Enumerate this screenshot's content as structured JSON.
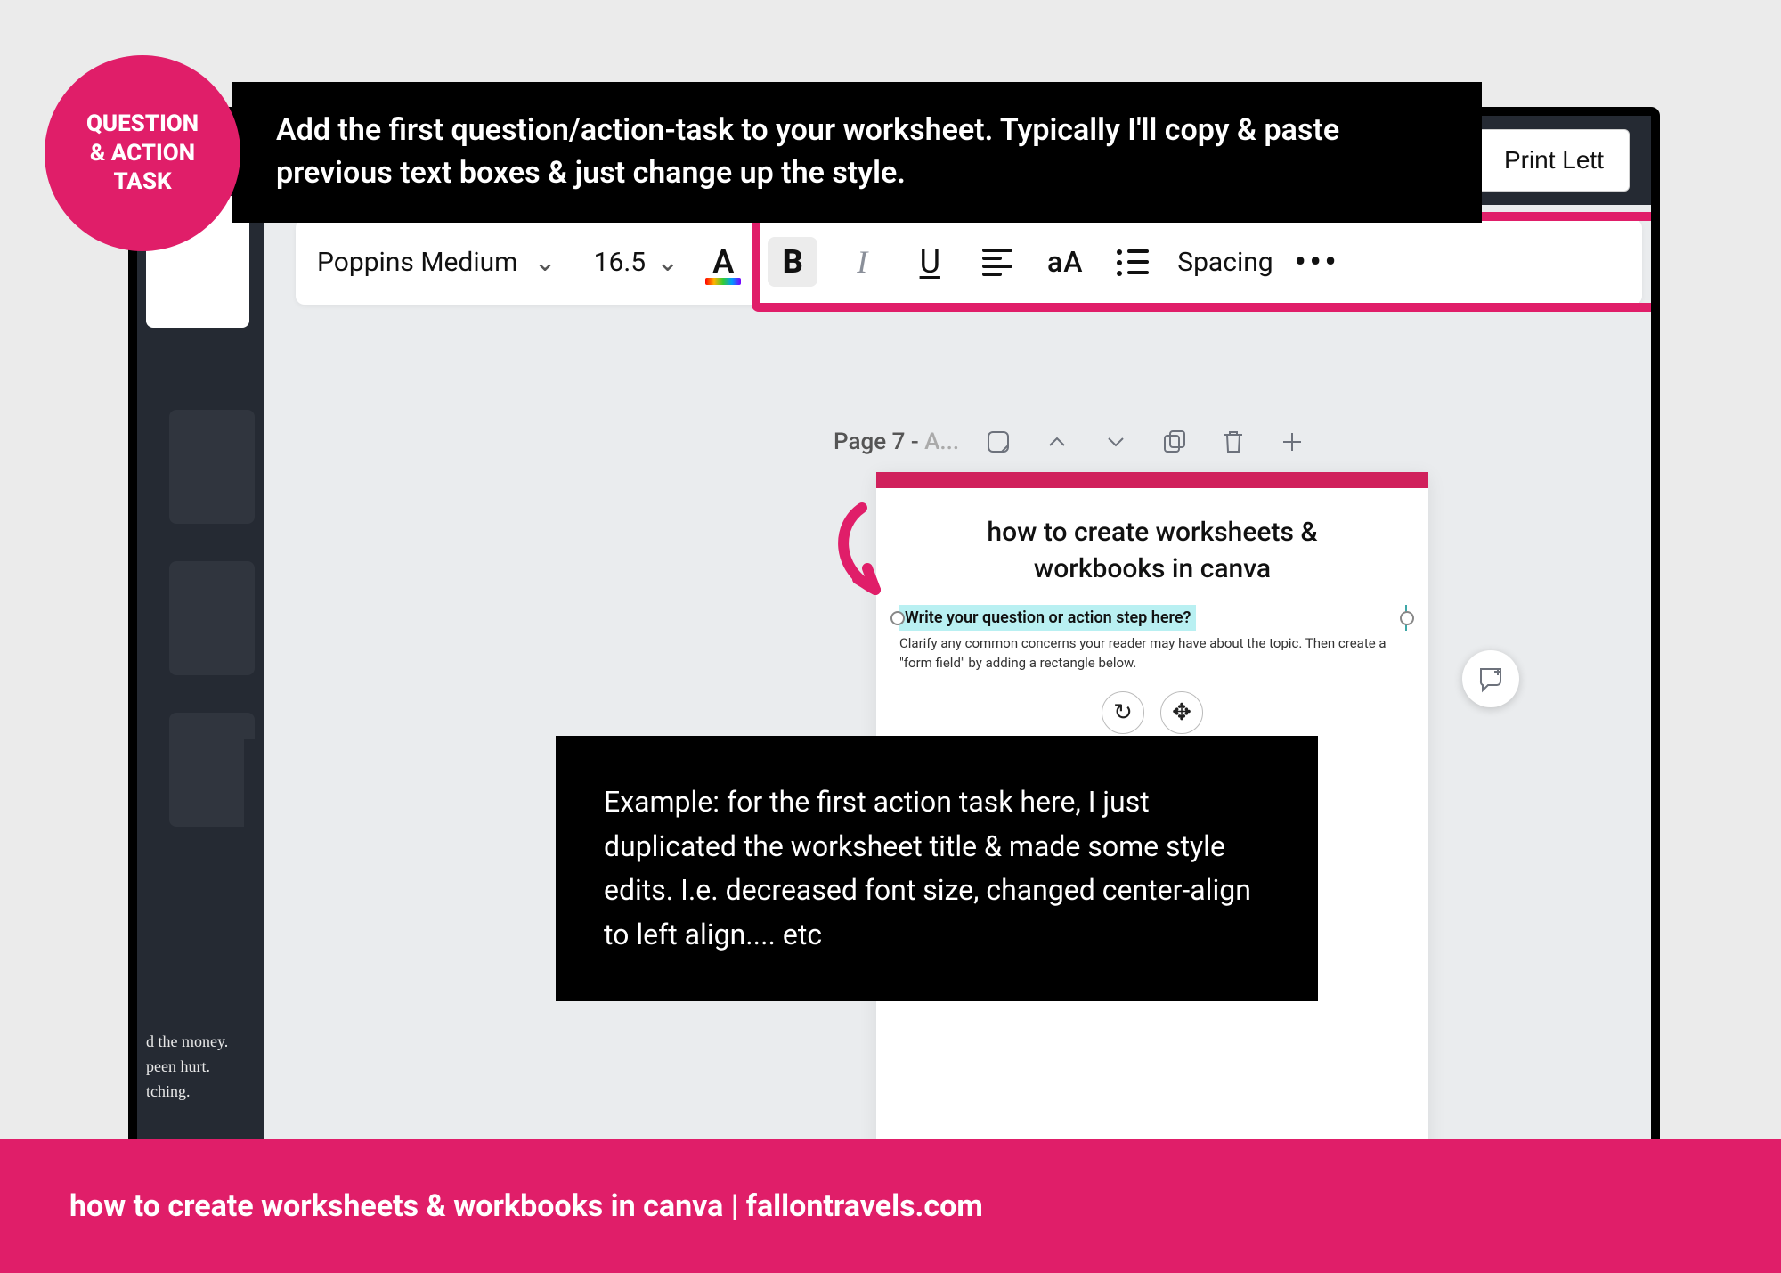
{
  "badge": {
    "line1": "QUESTION",
    "line2": "& ACTION",
    "line3": "TASK"
  },
  "instruction": "Add the first question/action-task to your worksheet. Typically I'll copy & paste previous text boxes & just change up the style.",
  "example": "Example: for the first action task here, I just duplicated the worksheet title & made some style edits. I.e. decreased font size, changed center-align to left align.... etc",
  "footer": "how to create worksheets & workbooks in canva | fallontravels.com",
  "app": {
    "print_button": "Print Lett",
    "toolbar": {
      "font": "Poppins Medium",
      "size": "16.5",
      "spacing": "Spacing",
      "aa": "aA"
    },
    "page_label_prefix": "Page 7 - ",
    "page_label_suffix": "A...",
    "worksheet_title": "how to create worksheets & workbooks in canva",
    "selected_text": "Write your question or action step here?",
    "helper_text": "Clarify any common concerns your reader may have about the topic. Then create a \"form field\" by adding a rectangle below.",
    "sidebar_text": "d the money.\npeen hurt.\ntching."
  },
  "colors": {
    "brand_pink": "#e01e69",
    "blue_accent": "#0aa3ff"
  }
}
